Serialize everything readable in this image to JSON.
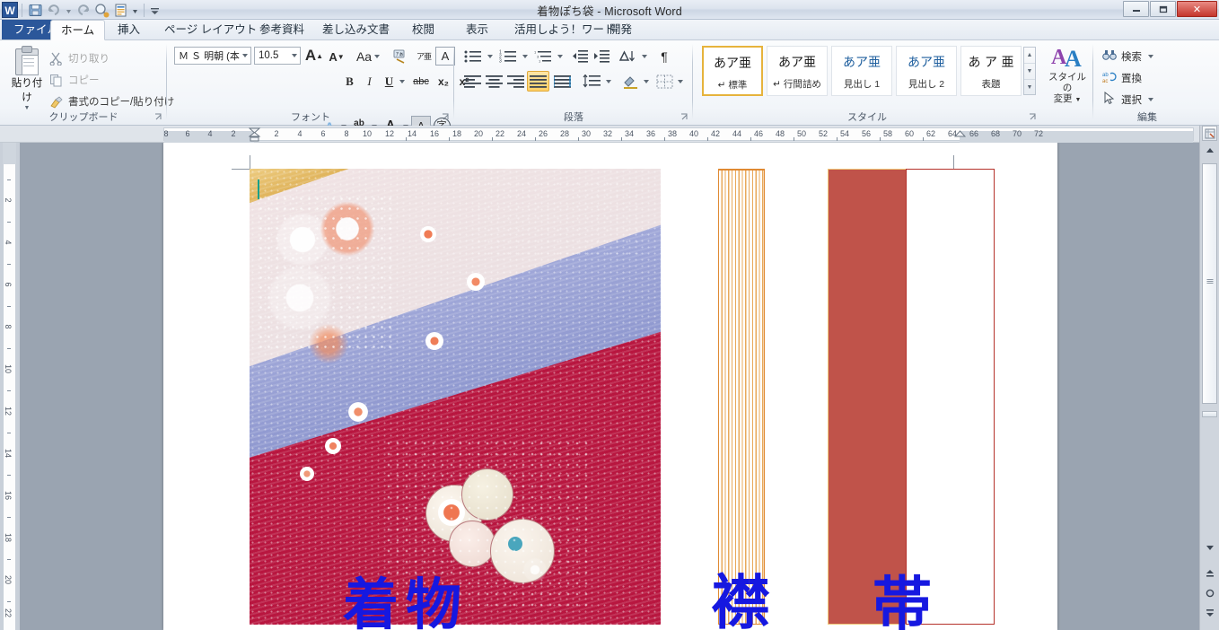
{
  "window": {
    "title": "着物ぽち袋 - Microsoft Word",
    "minimize_label": "—",
    "restore_label": "❐",
    "close_label": "✕",
    "help_label": "?",
    "collapse_ribbon_label": "⌃"
  },
  "quick_access": {
    "app_logo": "W",
    "items": [
      {
        "name": "save-icon",
        "label": "💾"
      },
      {
        "name": "undo-icon",
        "label": "↶"
      },
      {
        "name": "redo-icon",
        "label": "↻"
      },
      {
        "name": "print-preview-icon",
        "label": "🔍"
      },
      {
        "name": "quick-print-icon",
        "label": "📋"
      },
      {
        "name": "customize-qat-icon",
        "label": "▾"
      }
    ]
  },
  "tabs": [
    {
      "label": "ファイル",
      "active": false,
      "file": true
    },
    {
      "label": "ホーム",
      "active": true,
      "file": false
    },
    {
      "label": "挿入",
      "active": false,
      "file": false
    },
    {
      "label": "ページ レイアウト",
      "active": false,
      "file": false
    },
    {
      "label": "参考資料",
      "active": false,
      "file": false
    },
    {
      "label": "差し込み文書",
      "active": false,
      "file": false
    },
    {
      "label": "校閲",
      "active": false,
      "file": false
    },
    {
      "label": "表示",
      "active": false,
      "file": false
    },
    {
      "label": "活用しよう！ワード",
      "active": false,
      "file": false
    },
    {
      "label": "開発",
      "active": false,
      "file": false
    }
  ],
  "ribbon": {
    "clipboard": {
      "group_label": "クリップボード",
      "paste_label": "貼り付け",
      "cut_label": "切り取り",
      "copy_label": "コピー",
      "format_painter_label": "書式のコピー/貼り付け"
    },
    "font": {
      "group_label": "フォント",
      "font_name": "Ｍ Ｓ 明朝 (本",
      "font_size": "10.5",
      "grow_label": "A",
      "shrink_label": "A",
      "change_case_label": "Aa",
      "bold_label": "B",
      "italic_label": "I",
      "underline_label": "U",
      "strike_label": "abc",
      "subscript_label": "x₂",
      "superscript_label": "x²",
      "text_effects_label": "A",
      "highlight_label": "ab",
      "font_color_label": "A",
      "phonetic_label": "ア亜",
      "enclose_label": "字",
      "char_border_label": "A",
      "clear_format_label": "A"
    },
    "paragraph": {
      "group_label": "段落",
      "bullets_label": "≔",
      "numbering_label": "≔",
      "multilevel_label": "≔",
      "decrease_indent_label": "⇤",
      "increase_indent_label": "⇥",
      "sort_label": "A↓",
      "show_marks_label": "¶",
      "align_left_label": "≡",
      "align_center_label": "≡",
      "align_right_label": "≡",
      "justify_label": "≡",
      "distribute_label": "≣",
      "line_spacing_label": "↕≡",
      "shading_label": "▨",
      "borders_label": "⊞",
      "active_alignment": "justify"
    },
    "styles": {
      "group_label": "スタイル",
      "preview_text": "あア亜",
      "items": [
        {
          "preview": "あア亜",
          "name": "↵ 標準",
          "selected": true
        },
        {
          "preview": "あア亜",
          "name": "↵ 行間詰め",
          "selected": false
        },
        {
          "preview": "あア亜",
          "name": "見出し 1",
          "selected": false
        },
        {
          "preview": "あア亜",
          "name": "見出し 2",
          "selected": false
        },
        {
          "preview": "あ ア 亜",
          "name": "表題",
          "selected": false
        }
      ],
      "change_styles_label": "スタイルの\n変更"
    },
    "editing": {
      "group_label": "編集",
      "find_label": "検索",
      "replace_label": "置換",
      "select_label": "選択"
    }
  },
  "rulers": {
    "horizontal_ticks": [
      "8",
      "6",
      "4",
      "2",
      "2",
      "4",
      "6",
      "8",
      "10",
      "12",
      "14",
      "16",
      "18",
      "20",
      "22",
      "24",
      "26",
      "28",
      "30",
      "32",
      "34",
      "36",
      "38",
      "40",
      "42",
      "44",
      "46",
      "48",
      "50",
      "52",
      "54",
      "56",
      "58",
      "60",
      "62",
      "64",
      "66",
      "68",
      "70",
      "72"
    ],
    "vertical_ticks": [
      "2",
      "4",
      "6",
      "8",
      "10",
      "12",
      "14",
      "16",
      "18",
      "20",
      "22"
    ]
  },
  "document": {
    "shapes": [
      {
        "name": "kimono-picture",
        "caption": "着物",
        "caption_color": "#1618e0"
      },
      {
        "name": "collar-shape",
        "caption": "襟",
        "caption_color": "#1618e0",
        "fill": "striped-orange"
      },
      {
        "name": "obi-shape",
        "caption": "帯",
        "caption_color": "#1618e0",
        "fill": "#c0534a"
      }
    ],
    "captions": {
      "kimono": "着物",
      "collar": "襟",
      "obi": "帯"
    }
  },
  "scrollbar": {
    "up_label": "▲",
    "down_label": "▼",
    "previous_page_label": "⯅",
    "browse_object_label": "○",
    "next_page_label": "⯆",
    "split_label": ""
  }
}
